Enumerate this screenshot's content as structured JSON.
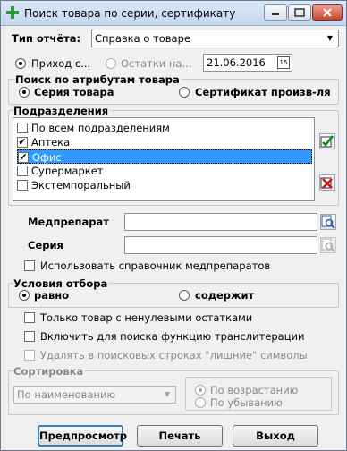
{
  "window": {
    "title": "Поиск товара по серии, сертификату"
  },
  "report_type": {
    "label": "Тип отчёта:",
    "value": "Справка о товаре"
  },
  "date_mode": {
    "option_income": "Приход с...",
    "option_balance": "Остатки на...",
    "date_value": "21.06.2016"
  },
  "search_by": {
    "group_label": "Поиск по атрибутам товара",
    "option_series": "Серия товара",
    "option_certificate": "Сертификат произв-ля"
  },
  "divisions": {
    "group_label": "Подразделения",
    "items": [
      {
        "label": "По всем подразделениям",
        "checked": false
      },
      {
        "label": "Аптека",
        "checked": true
      },
      {
        "label": "Офис",
        "checked": true
      },
      {
        "label": "Супермаркет",
        "checked": false
      },
      {
        "label": "Экстемпоральный",
        "checked": false
      }
    ]
  },
  "fields": {
    "drug_label": "Медпрепарат",
    "drug_value": "",
    "series_label": "Серия",
    "series_value": ""
  },
  "options": {
    "use_drug_reference": "Использовать справочник медпрепаратов"
  },
  "filter": {
    "group_label": "Условия отбора",
    "option_equals": "равно",
    "option_contains": "содержит"
  },
  "checks": {
    "nonzero_only": "Только товар с ненулевыми остатками",
    "transliteration": "Включить для поиска функцию транслитерации",
    "remove_extra": "Удалять в поисковых строках \"лишние\" символы"
  },
  "sorting": {
    "group_label": "Сортировка",
    "value": "По наименованию",
    "ascending": "По возрастанию",
    "descending": "По убыванию"
  },
  "buttons": {
    "preview": "Предпросмотр",
    "print": "Печать",
    "exit": "Выход"
  },
  "colors": {
    "selection": "#3399ff",
    "title_bar": "#c6d8ee",
    "close_button": "#c8462b"
  }
}
